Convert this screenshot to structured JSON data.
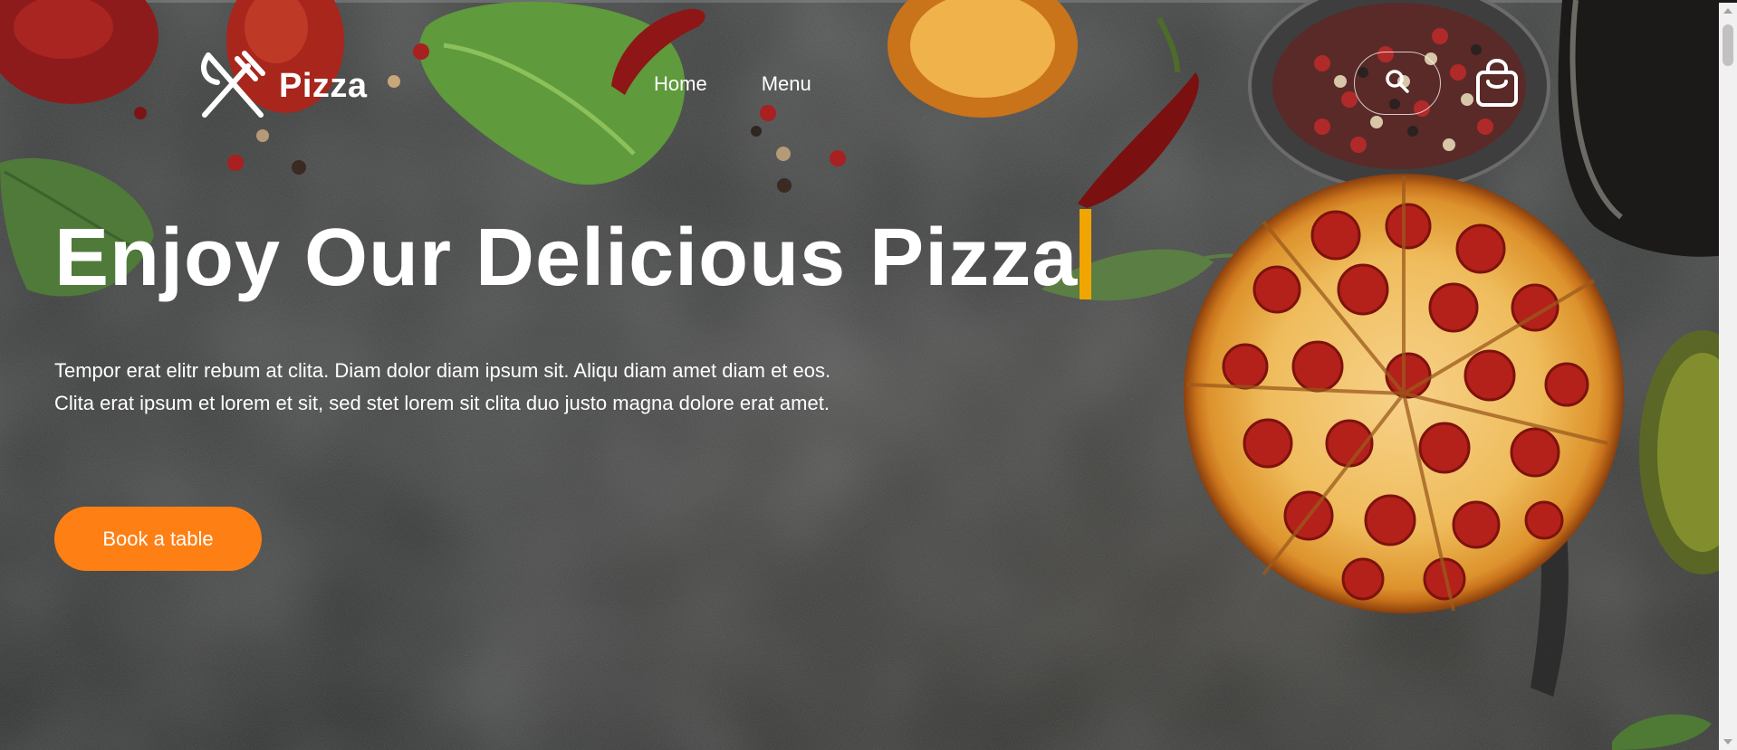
{
  "brand": {
    "name": "Pizza",
    "logo_icon": "fork-knife-icon"
  },
  "nav": {
    "items": [
      {
        "label": "Home"
      },
      {
        "label": "Menu"
      }
    ]
  },
  "header_actions": {
    "search_icon": "search-icon",
    "cart_icon": "shopping-bag-icon"
  },
  "hero": {
    "title": "Enjoy Our Delicious Pizza",
    "description": "Tempor erat elitr rebum at clita. Diam dolor diam ipsum sit. Aliqu diam amet diam et eos. Clita erat ipsum et lorem et sit, sed stet lorem sit clita duo justo magna dolore erat amet.",
    "cta_label": "Book a table"
  },
  "colors": {
    "accent": "#fe7f14",
    "caret": "#f0a500",
    "background": "#2f3130",
    "text": "#ffffff"
  }
}
